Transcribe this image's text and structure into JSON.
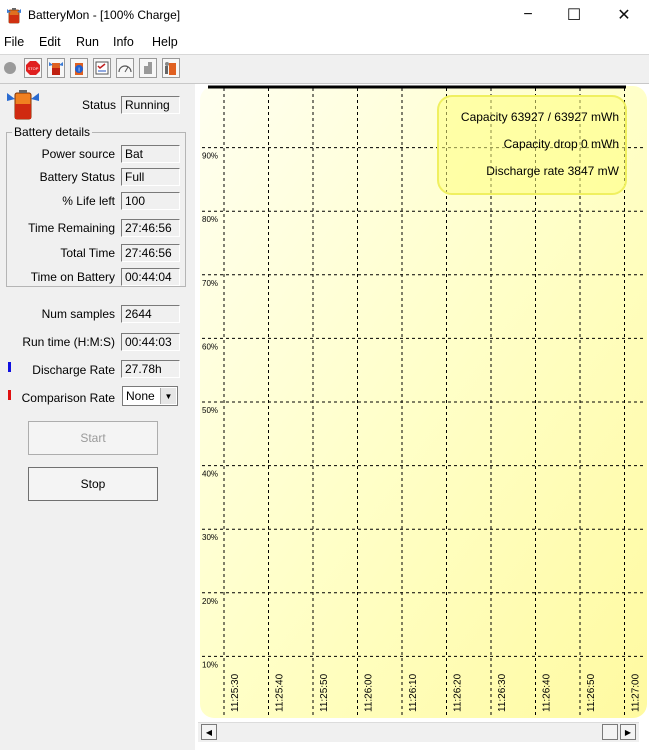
{
  "window": {
    "title": "BatteryMon - [100% Charge]",
    "controls": {
      "minimize": "−",
      "maximize": "☐",
      "close": "✕"
    }
  },
  "menu": [
    "File",
    "Edit",
    "Run",
    "Info",
    "Help"
  ],
  "toolbar": {
    "buttons": [
      "record-icon",
      "stop-icon",
      "battery-icon",
      "info-icon",
      "checklist-icon",
      "gauge-icon",
      "cursor-icon",
      "battery-settings-icon"
    ]
  },
  "status": {
    "label": "Status",
    "value": "Running"
  },
  "battery_details": {
    "title": "Battery details",
    "power_source": {
      "label": "Power source",
      "value": "Bat"
    },
    "battery_status": {
      "label": "Battery Status",
      "value": "Full"
    },
    "life_left": {
      "label": "% Life left",
      "value": "100"
    },
    "time_remaining": {
      "label": "Time Remaining",
      "value": "27:46:56"
    },
    "total_time": {
      "label": "Total Time",
      "value": "27:46:56"
    },
    "time_on_battery": {
      "label": "Time on Battery",
      "value": "00:44:04"
    }
  },
  "num_samples": {
    "label": "Num samples",
    "value": "2644"
  },
  "run_time": {
    "label": "Run time (H:M:S)",
    "value": "00:44:03"
  },
  "discharge_rate": {
    "label": "Discharge Rate",
    "value": "27.78h",
    "marker_color": "#1010e0"
  },
  "comparison_rate": {
    "label": "Comparison Rate",
    "value": "None",
    "marker_color": "#e01010"
  },
  "buttons": {
    "start": "Start",
    "stop": "Stop"
  },
  "chart_data": {
    "type": "line",
    "y_ticks": [
      "10%",
      "20%",
      "30%",
      "40%",
      "50%",
      "60%",
      "70%",
      "80%",
      "90%"
    ],
    "x_ticks": [
      "11:25:30",
      "11:25:40",
      "11:25:50",
      "11:26:00",
      "11:26:10",
      "11:26:20",
      "11:26:30",
      "11:26:40",
      "11:26:50",
      "11:27:00"
    ],
    "series": [
      {
        "values": [
          100,
          100,
          100,
          100,
          100,
          100,
          100,
          100,
          100,
          100
        ],
        "color": "#000000"
      }
    ],
    "ylim": [
      0,
      100
    ],
    "grid": true,
    "background": "#ffffc8",
    "info_box": {
      "capacity": "Capacity 63927 / 63927 mWh",
      "capacity_drop": "Capacity drop 0 mWh",
      "discharge_rate": "Discharge rate 3847 mW"
    }
  }
}
